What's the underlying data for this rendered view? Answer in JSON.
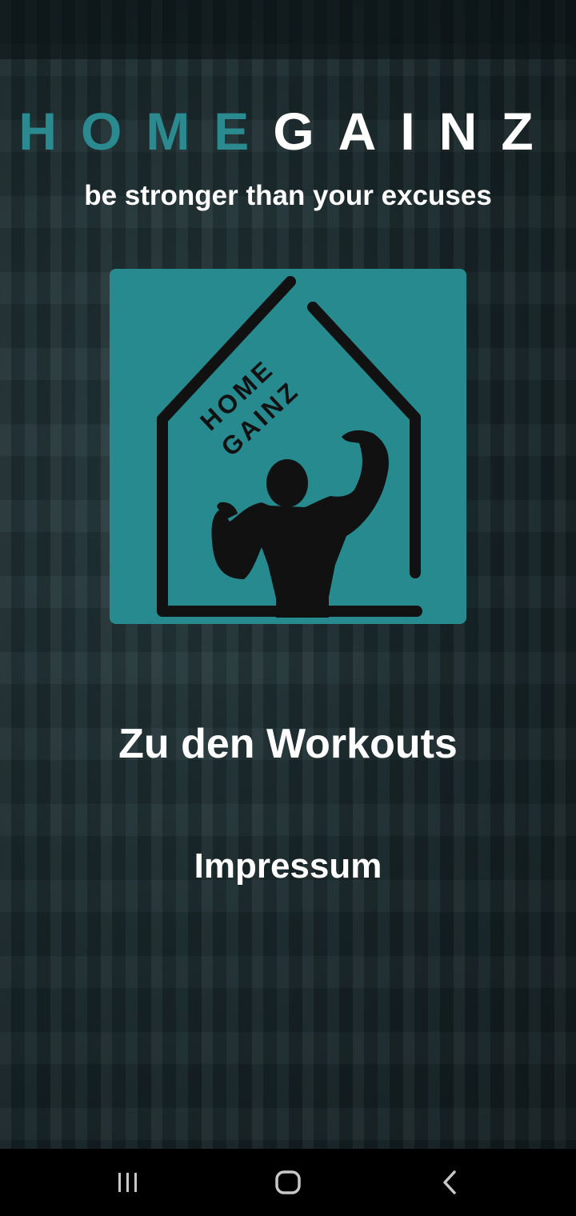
{
  "header": {
    "brand_home": "HOME",
    "brand_gainz": "GAINZ",
    "tagline": "be stronger than your excuses"
  },
  "logo": {
    "text_line1": "HOME",
    "text_line2": "GAINZ",
    "icon": "house-bodybuilder-logo"
  },
  "menu": {
    "workouts_label": "Zu den Workouts",
    "impressum_label": "Impressum"
  },
  "navbar": {
    "recents_icon": "recent-apps-icon",
    "home_icon": "home-icon",
    "back_icon": "back-icon"
  },
  "colors": {
    "accent": "#2a8a8f",
    "logo_bg": "#268a8f",
    "text": "#ffffff",
    "navbar": "#000000"
  }
}
